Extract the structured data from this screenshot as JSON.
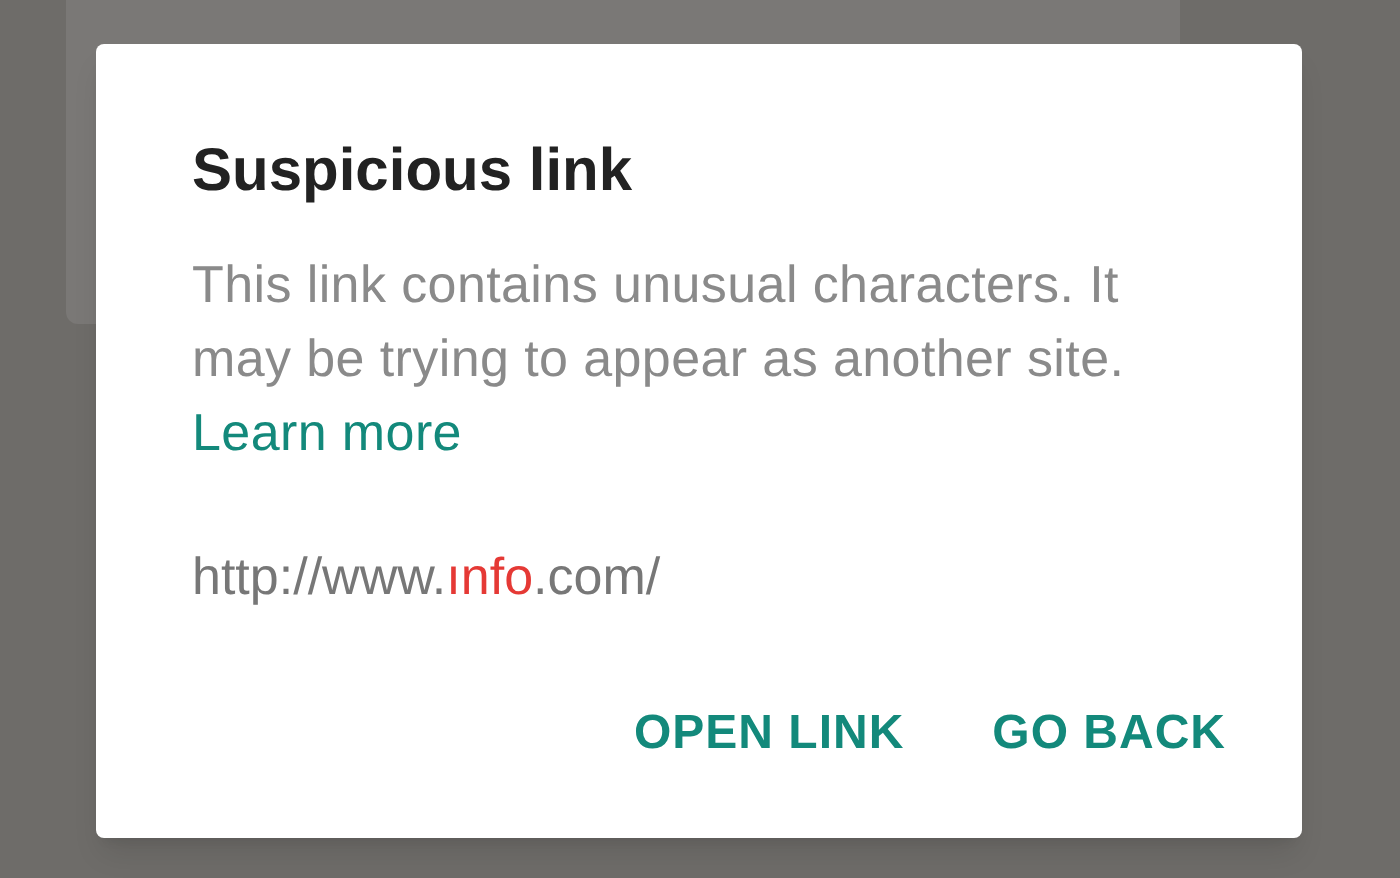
{
  "dialog": {
    "title": "Suspicious link",
    "message": "This link contains unusual characters. It may be trying to appear as another site.",
    "link": "Learn more",
    "url": [
      {
        "text": "http://www.",
        "suspicious": false
      },
      {
        "text": "ınfo",
        "suspicious": true
      },
      {
        "text": ".com/",
        "suspicious": false
      }
    ],
    "buttons": [
      "OPEN LINK",
      "GO BACK"
    ]
  }
}
